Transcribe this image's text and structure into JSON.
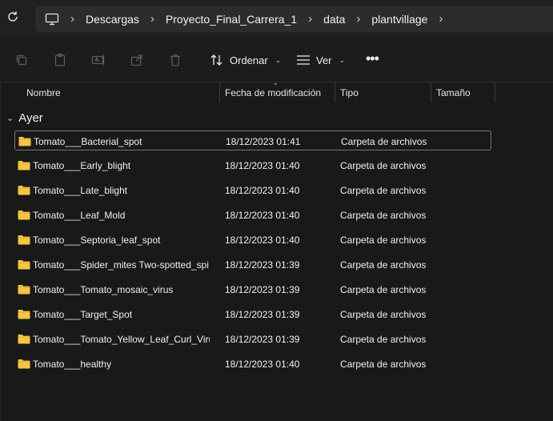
{
  "breadcrumb": {
    "items": [
      "Descargas",
      "Proyecto_Final_Carrera_1",
      "data",
      "plantvillage"
    ]
  },
  "toolbar": {
    "sort_label": "Ordenar",
    "view_label": "Ver",
    "more_label": "•••"
  },
  "columns": {
    "name": "Nombre",
    "date": "Fecha de modificación",
    "type": "Tipo",
    "size": "Tamaño"
  },
  "group": {
    "label": "Ayer"
  },
  "files": [
    {
      "name": "Tomato___Bacterial_spot",
      "date": "18/12/2023 01:41",
      "type": "Carpeta de archivos"
    },
    {
      "name": "Tomato___Early_blight",
      "date": "18/12/2023 01:40",
      "type": "Carpeta de archivos"
    },
    {
      "name": "Tomato___Late_blight",
      "date": "18/12/2023 01:40",
      "type": "Carpeta de archivos"
    },
    {
      "name": "Tomato___Leaf_Mold",
      "date": "18/12/2023 01:40",
      "type": "Carpeta de archivos"
    },
    {
      "name": "Tomato___Septoria_leaf_spot",
      "date": "18/12/2023 01:40",
      "type": "Carpeta de archivos"
    },
    {
      "name": "Tomato___Spider_mites Two-spotted_spi...",
      "date": "18/12/2023 01:39",
      "type": "Carpeta de archivos"
    },
    {
      "name": "Tomato___Tomato_mosaic_virus",
      "date": "18/12/2023 01:39",
      "type": "Carpeta de archivos"
    },
    {
      "name": "Tomato___Target_Spot",
      "date": "18/12/2023 01:39",
      "type": "Carpeta de archivos"
    },
    {
      "name": "Tomato___Tomato_Yellow_Leaf_Curl_Virus",
      "date": "18/12/2023 01:39",
      "type": "Carpeta de archivos"
    },
    {
      "name": "Tomato___healthy",
      "date": "18/12/2023 01:40",
      "type": "Carpeta de archivos"
    }
  ],
  "colors": {
    "folder": "#f6c544",
    "background": "#191919",
    "selection_border": "#777777"
  }
}
